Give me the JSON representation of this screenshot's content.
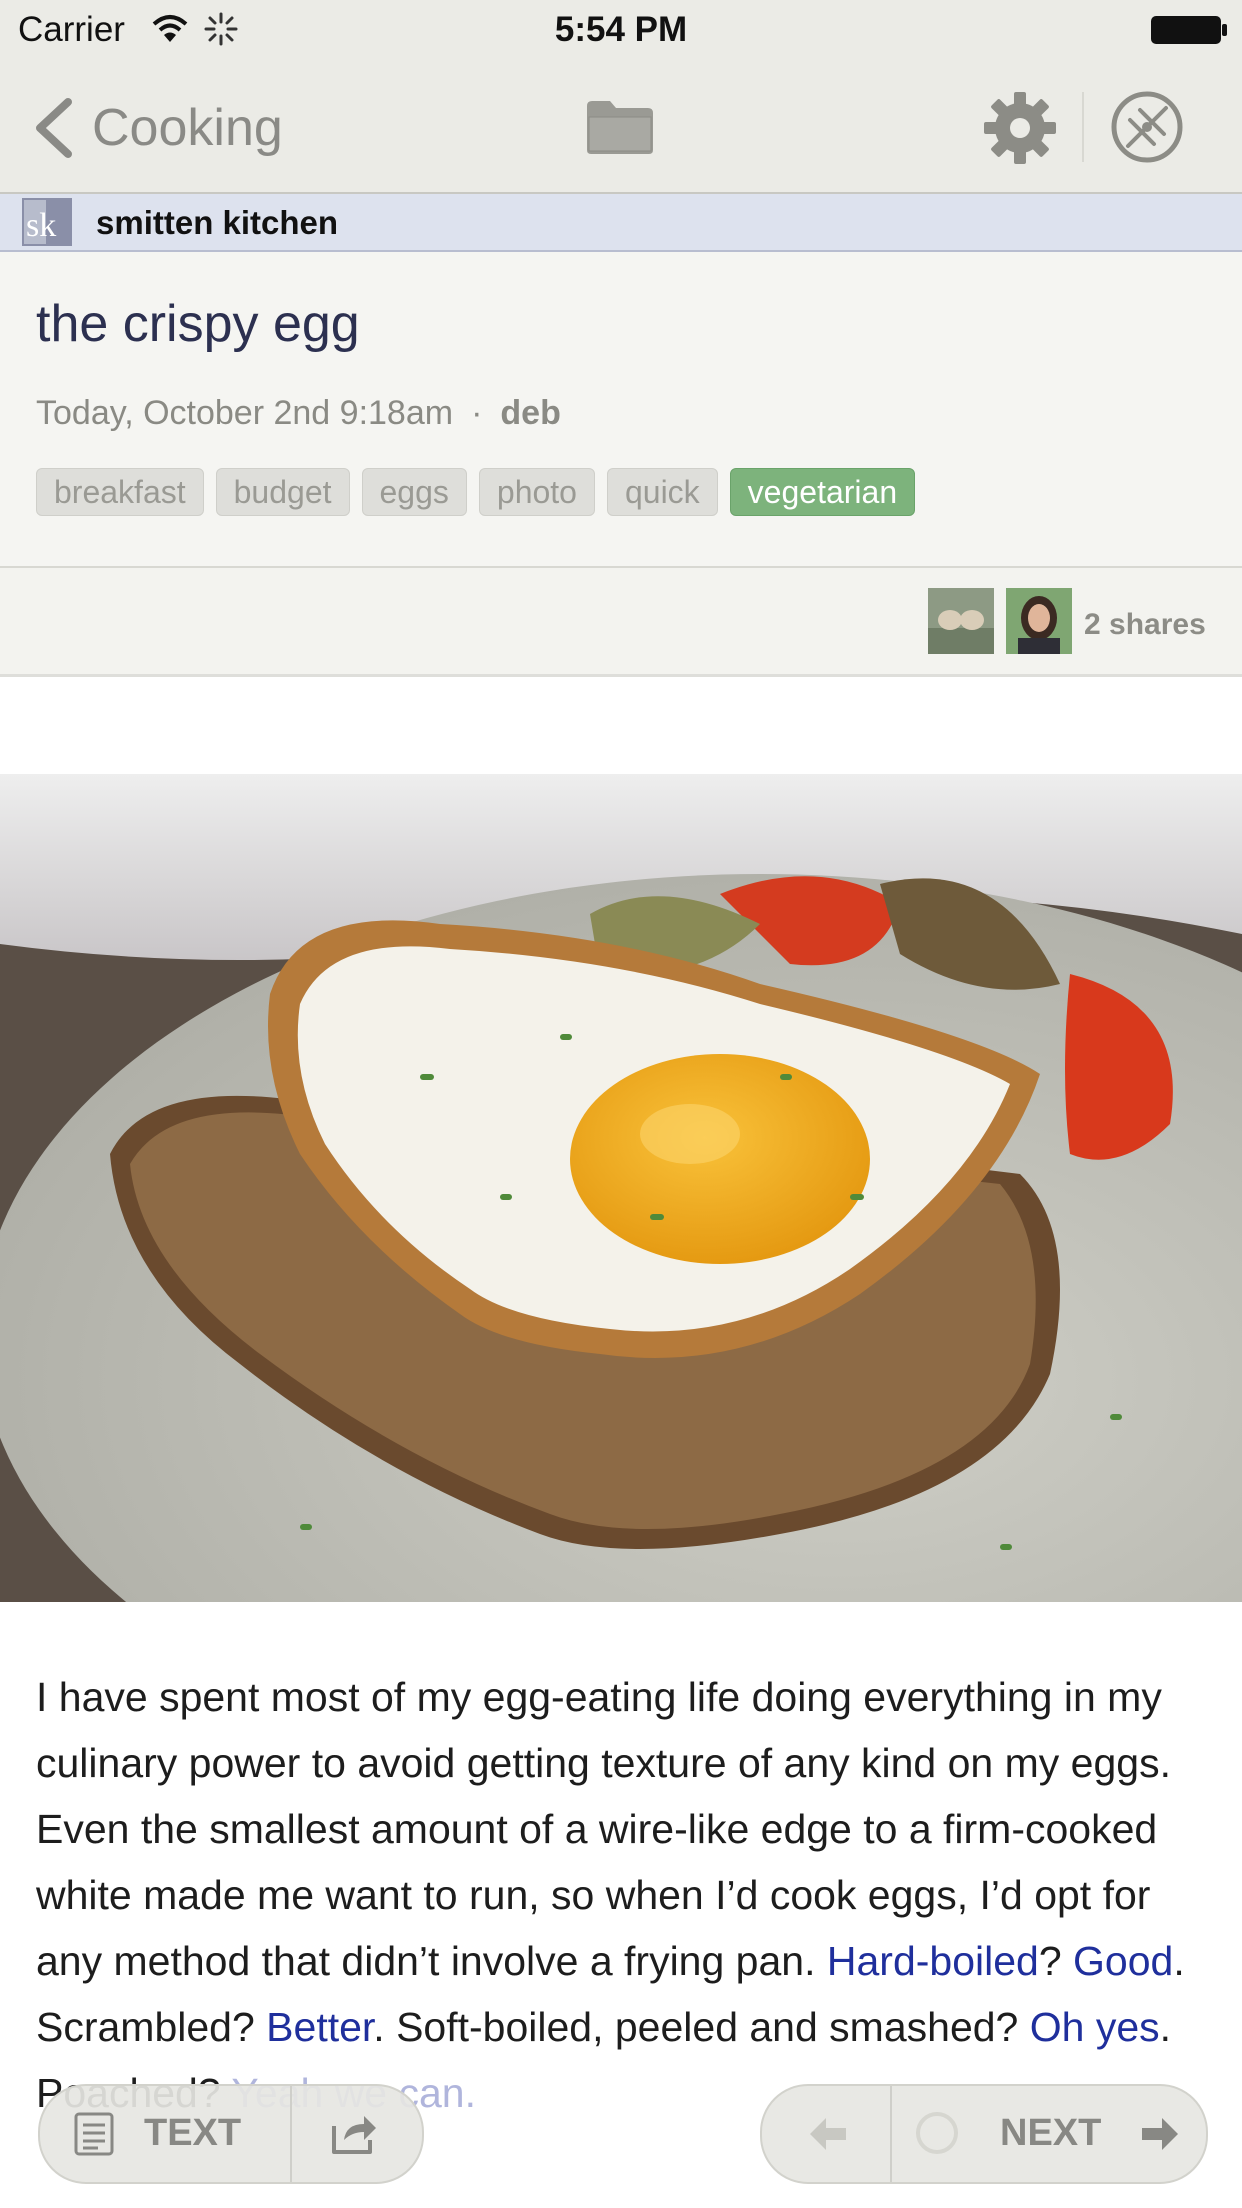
{
  "status_bar": {
    "carrier": "Carrier",
    "time": "5:54 PM"
  },
  "nav": {
    "back_label": "Cooking",
    "icons": [
      "chevron-left-icon",
      "folder-icon",
      "gear-icon",
      "compass-icon"
    ]
  },
  "feed": {
    "name": "smitten kitchen",
    "logo_text": "sk"
  },
  "article": {
    "title": "the crispy egg",
    "date": "Today, October 2nd 9:18am",
    "separator": "·",
    "author": "deb",
    "tags": [
      {
        "label": "breakfast",
        "active": false
      },
      {
        "label": "budget",
        "active": false
      },
      {
        "label": "eggs",
        "active": false
      },
      {
        "label": "photo",
        "active": false
      },
      {
        "label": "quick",
        "active": false
      },
      {
        "label": "vegetarian",
        "active": true
      }
    ],
    "shares": "2 shares",
    "body": {
      "t1": "I have spent most of my egg-eating life doing everything in my culinary power to avoid getting texture of any kind on my eggs. Even the smallest amount of a wire-like edge to a firm-cooked white made me want to run, so when I’d cook eggs, I’d opt for any method that didn’t involve a frying pan. ",
      "l1": "Hard-boiled",
      "t2": "? ",
      "l2": "Good",
      "t3": ". Scrambled? ",
      "l3": "Better",
      "t4": ". Soft-boiled, peeled and smashed? ",
      "l4": "Oh yes",
      "t5": ". Poached? ",
      "l5": "Yeah we can."
    }
  },
  "toolbar": {
    "text_label": "TEXT",
    "next_label": "NEXT"
  },
  "colors": {
    "tag_active": "#7db37c",
    "link": "#1f2f9c",
    "title": "#2c3050",
    "bar": "#ebebe6"
  }
}
